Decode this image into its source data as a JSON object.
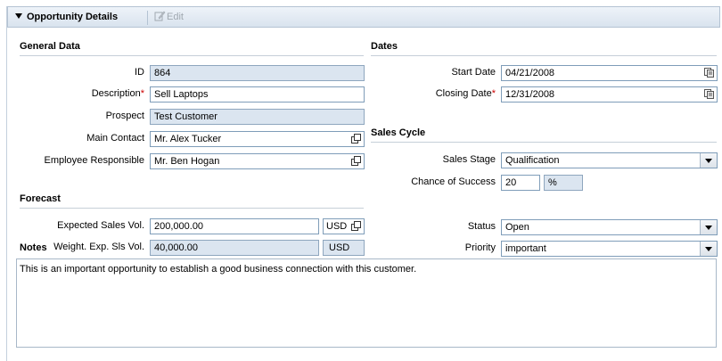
{
  "header": {
    "title": "Opportunity Details",
    "edit_label": "Edit"
  },
  "general": {
    "title": "General Data",
    "id_label": "ID",
    "id_value": "864",
    "desc_label": "Description",
    "desc_value": "Sell Laptops",
    "prospect_label": "Prospect",
    "prospect_value": "Test Customer",
    "contact_label": "Main Contact",
    "contact_value": "Mr. Alex Tucker",
    "employee_label": "Employee Responsible",
    "employee_value": "Mr. Ben Hogan"
  },
  "dates": {
    "title": "Dates",
    "start_label": "Start Date",
    "start_value": "04/21/2008",
    "closing_label": "Closing Date",
    "closing_value": "12/31/2008"
  },
  "sales_cycle": {
    "title": "Sales Cycle",
    "stage_label": "Sales Stage",
    "stage_value": "Qualification",
    "chance_label": "Chance of Success",
    "chance_value": "20",
    "chance_unit": "%"
  },
  "forecast": {
    "title": "Forecast",
    "expected_label": "Expected Sales Vol.",
    "expected_value": "200,000.00",
    "expected_currency": "USD",
    "weighted_label": "Weight. Exp. Sls Vol.",
    "weighted_value": "40,000.00",
    "weighted_currency": "USD",
    "status_label": "Status",
    "status_value": "Open",
    "priority_label": "Priority",
    "priority_value": "important"
  },
  "notes": {
    "title": "Notes",
    "text": "This is an important opportunity to establish a good business connection with this customer."
  },
  "colors": {
    "readonly_bg": "#dbe5f0",
    "border": "#7f9db9",
    "required": "#cc0000"
  }
}
